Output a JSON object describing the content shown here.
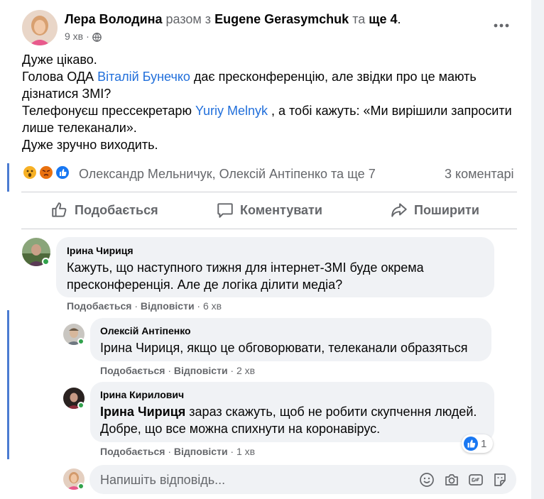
{
  "post": {
    "author": "Лера Володина",
    "with_prefix": "разом з",
    "with_person": "Eugene Gerasymchuk",
    "and_text": "та",
    "others": "ще 4",
    "dot": ".",
    "time": "9 хв",
    "separator": "·",
    "line1": "Дуже цікаво.",
    "line2_a": "Голова ОДА ",
    "line2_link": "Віталій Бунечко",
    "line2_b": " дає пресконференцію, але звідки про це мають дізнатися ЗМІ?",
    "line3_a": "Телефонуєш прессекретарю ",
    "line3_link": "Yuriy Melnyk",
    "line3_b": " , а тобі кажуть: «Ми вирішили запросити лише телеканали».",
    "line4": "Дуже зручно виходить."
  },
  "reactions": {
    "people": "Олександр Мельничук, Олексій Антіпенко та ще 7",
    "comments_count": "3 коментарі"
  },
  "actions": {
    "like": "Подобається",
    "comment": "Коментувати",
    "share": "Поширити"
  },
  "comments": [
    {
      "author": "Ірина Чириця",
      "text": "Кажуть, що наступного тижня для інтернет-ЗМІ буде окрема пресконференція. Але де логіка ділити медіа?",
      "like": "Подобається",
      "reply": "Відповісти",
      "time": "6 хв"
    },
    {
      "author": "Олексій Антіпенко",
      "text": "Ірина Чириця, якщо це обговорювати, телеканали образяться",
      "like": "Подобається",
      "reply": "Відповісти",
      "time": "2 хв"
    },
    {
      "author": "Ірина Кирилович",
      "mention": "Ірина Чириця",
      "text": " зараз скажуть, щоб не робити скупчення людей. Добре, що все можна спихнути на коронавірус.",
      "like": "Подобається",
      "reply": "Відповісти",
      "time": "1 хв",
      "reaction_count": "1"
    }
  ],
  "reply_box": {
    "placeholder": "Напишіть відповідь..."
  },
  "colors": {
    "link": "#216fdb",
    "muted": "#65676b",
    "bubble": "#f0f2f5",
    "online": "#31a24c"
  }
}
